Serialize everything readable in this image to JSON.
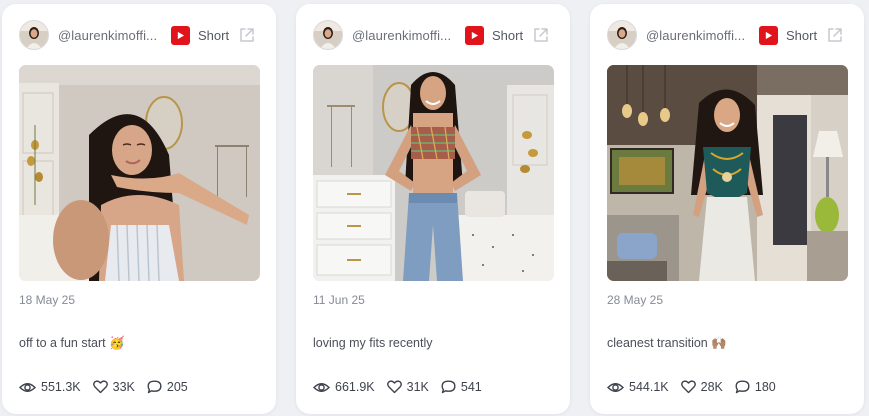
{
  "cards": [
    {
      "handle": "@laurenkimoffi...",
      "platform_icon": "youtube-icon",
      "type": "Short",
      "date": "18 May 25",
      "caption": "off to a fun start 🥳",
      "views": "551.3K",
      "likes": "33K",
      "comments": "205"
    },
    {
      "handle": "@laurenkimoffi...",
      "platform_icon": "youtube-icon",
      "type": "Short",
      "date": "11 Jun 25",
      "caption": "loving my fits recently",
      "views": "661.9K",
      "likes": "31K",
      "comments": "541"
    },
    {
      "handle": "@laurenkimoffi...",
      "platform_icon": "youtube-icon",
      "type": "Short",
      "date": "28 May 25",
      "caption": "cleanest transition 🙌🏽",
      "views": "544.1K",
      "likes": "28K",
      "comments": "180"
    }
  ],
  "colors": {
    "youtube_red": "#e1141b",
    "card_bg": "#ffffff",
    "page_bg": "#eef0f4",
    "muted_text": "#868a95"
  }
}
